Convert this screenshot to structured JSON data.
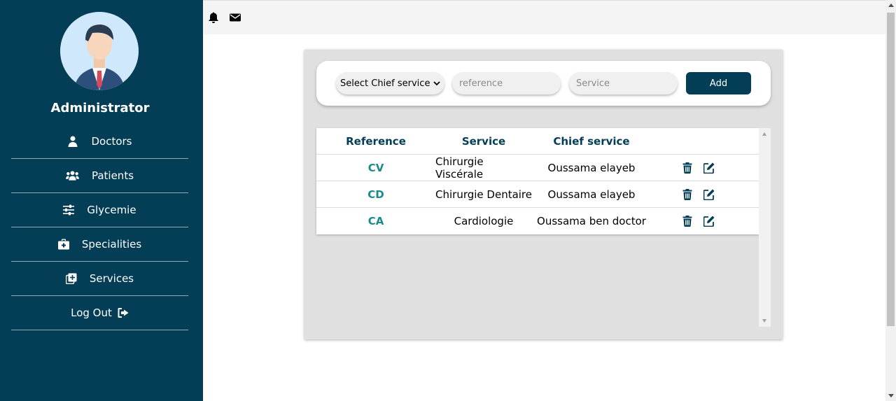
{
  "sidebar": {
    "role_title": "Administrator",
    "items": [
      {
        "label": "Doctors",
        "icon": "user-doctor-icon"
      },
      {
        "label": "Patients",
        "icon": "users-icon"
      },
      {
        "label": "Glycemie",
        "icon": "sliders-icon"
      },
      {
        "label": "Specialities",
        "icon": "medkit-icon"
      },
      {
        "label": "Services",
        "icon": "add-square-icon"
      },
      {
        "label": "Log Out",
        "icon": "sign-out-icon"
      }
    ]
  },
  "topbar": {
    "icons": [
      "bell-icon",
      "envelope-icon"
    ]
  },
  "form": {
    "select_value": "Select Chief service",
    "reference_placeholder": "reference",
    "service_placeholder": "Service",
    "add_label": "Add"
  },
  "table": {
    "headers": [
      "Reference",
      "Service",
      "Chief service"
    ],
    "rows": [
      {
        "reference": "CV",
        "service": "Chirurgie Viscérale",
        "chief": "Oussama elayeb"
      },
      {
        "reference": "CD",
        "service": "Chirurgie Dentaire",
        "chief": "Oussama elayeb"
      },
      {
        "reference": "CA",
        "service": "Cardiologie",
        "chief": "Oussama ben doctor"
      }
    ]
  },
  "colors": {
    "primary": "#033e56",
    "accent": "#1a8a8a",
    "card_bg": "#e0e0e0"
  }
}
